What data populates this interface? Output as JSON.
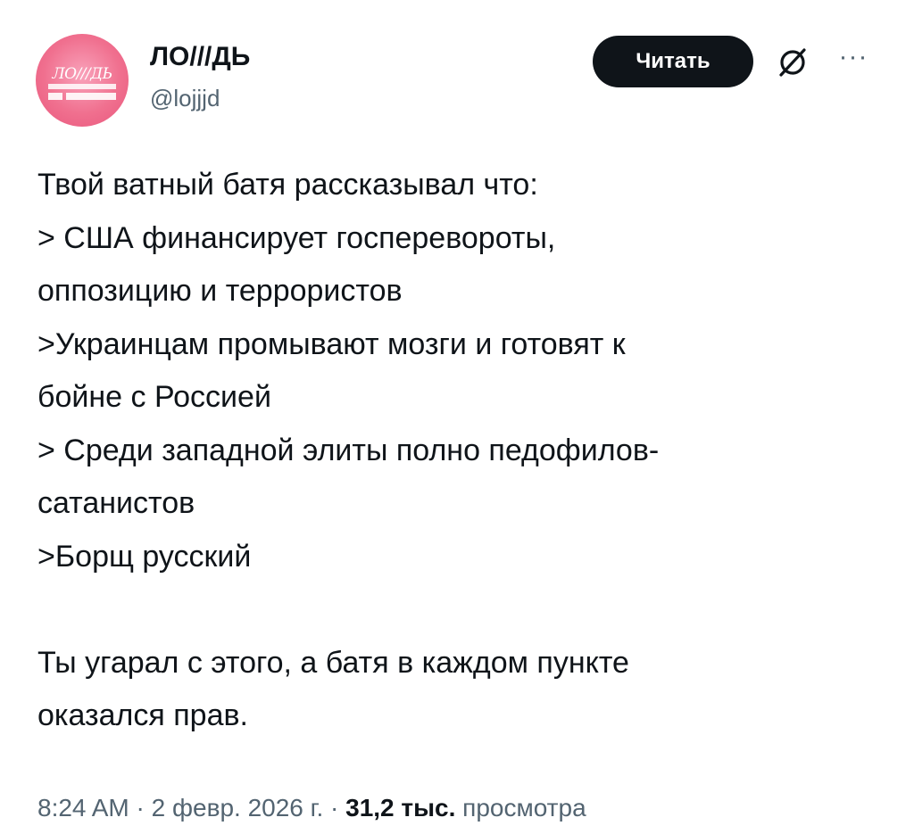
{
  "author": {
    "display_name": "ЛО///ДЬ",
    "handle": "@lojjjd",
    "avatar_text": "ЛО///ДЬ"
  },
  "actions": {
    "read_label": "Читать",
    "grok_icon": "grok-icon",
    "more_label": "···"
  },
  "post": {
    "lines": [
      "Твой ватный батя рассказывал что:",
      "> США  финансирует госперевороты,",
      "оппозицию и террористов",
      ">Украинцам промывают мозги и готовят к",
      "бойне с Россией",
      "> Среди западной элиты полно педофилов-",
      "сатанистов",
      ">Борщ русский"
    ],
    "closing_lines": [
      "Ты угарал с этого, а батя в каждом пункте",
      "оказался прав."
    ]
  },
  "meta": {
    "time": "8:24 AM",
    "separator": "·",
    "date": "2 февр. 2026 г.",
    "views_count": "31,2 тыс.",
    "views_label": "просмотра"
  },
  "colors": {
    "text": "#0f1419",
    "secondary": "#536471",
    "button_bg": "#0f1419",
    "avatar_pink": "#f0708f"
  }
}
